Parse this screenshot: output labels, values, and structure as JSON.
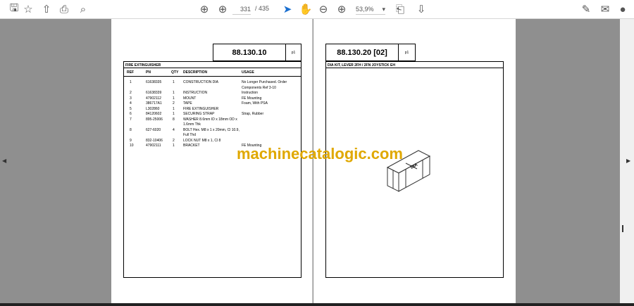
{
  "toolbar": {
    "page_current": "331",
    "page_total": "/ 435",
    "zoom": "53,9%"
  },
  "left_page": {
    "code": "88.130.10",
    "page_tag": "p1",
    "title": "FIRE EXTINGUISHER",
    "columns": [
      "REF",
      "PN",
      "QTY",
      "DESCRIPTION",
      "USAGE"
    ],
    "rows": [
      [
        "1",
        "61638335",
        "1",
        "CONSTRUCTION DIA",
        "No Longer Purchased. Order"
      ],
      [
        "",
        "",
        "",
        "",
        "Components Ref 3-10"
      ],
      [
        "2",
        "61638339",
        "1",
        "INSTRUCTION",
        "Instruction"
      ],
      [
        "3",
        "47902112",
        "1",
        "MOUNT",
        "FE Mounting"
      ],
      [
        "4",
        "386717A1",
        "2",
        "TAPE",
        "Foam, With PSA"
      ],
      [
        "5",
        "L302860",
        "1",
        "FIRE EXTINGUISHER",
        ""
      ],
      [
        "6",
        "84120602",
        "1",
        "SECURING STRAP",
        "Strap, Rubber"
      ],
      [
        "7",
        "895-25006",
        "8",
        "WASHER 8.6mm ID x 18mm OD x",
        ""
      ],
      [
        "",
        "",
        "",
        "1.6mm Thk",
        ""
      ],
      [
        "8",
        "627-6020",
        "4",
        "BOLT Hex. M8 x 1 x 20mm, Cl 10.9,",
        ""
      ],
      [
        "",
        "",
        "",
        "Full Thd",
        ""
      ],
      [
        "9",
        "832-10406",
        "2",
        "LOCK NUT M8 x 1, Cl 8",
        ""
      ],
      [
        "10",
        "47902111",
        "1",
        "BRACKET",
        "FE Mounting"
      ]
    ]
  },
  "right_page": {
    "code": "88.130.20 [02]",
    "page_tag": "p1",
    "title": "DIA KIT, LEVER 2FH / 2FN JOYSTICK EH",
    "crate_label": "DIA"
  },
  "watermark": "machinecatalogic.com"
}
